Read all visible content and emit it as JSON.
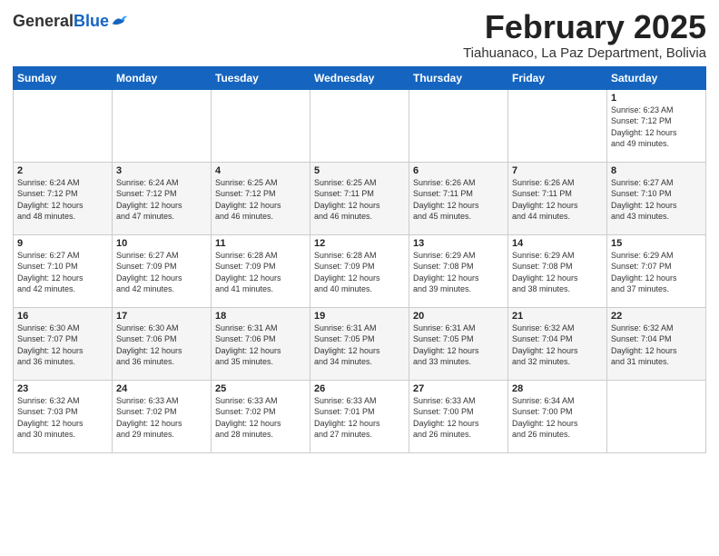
{
  "logo": {
    "general": "General",
    "blue": "Blue"
  },
  "title": {
    "month": "February 2025",
    "location": "Tiahuanaco, La Paz Department, Bolivia"
  },
  "headers": [
    "Sunday",
    "Monday",
    "Tuesday",
    "Wednesday",
    "Thursday",
    "Friday",
    "Saturday"
  ],
  "weeks": [
    [
      {
        "day": "",
        "info": ""
      },
      {
        "day": "",
        "info": ""
      },
      {
        "day": "",
        "info": ""
      },
      {
        "day": "",
        "info": ""
      },
      {
        "day": "",
        "info": ""
      },
      {
        "day": "",
        "info": ""
      },
      {
        "day": "1",
        "info": "Sunrise: 6:23 AM\nSunset: 7:12 PM\nDaylight: 12 hours\nand 49 minutes."
      }
    ],
    [
      {
        "day": "2",
        "info": "Sunrise: 6:24 AM\nSunset: 7:12 PM\nDaylight: 12 hours\nand 48 minutes."
      },
      {
        "day": "3",
        "info": "Sunrise: 6:24 AM\nSunset: 7:12 PM\nDaylight: 12 hours\nand 47 minutes."
      },
      {
        "day": "4",
        "info": "Sunrise: 6:25 AM\nSunset: 7:12 PM\nDaylight: 12 hours\nand 46 minutes."
      },
      {
        "day": "5",
        "info": "Sunrise: 6:25 AM\nSunset: 7:11 PM\nDaylight: 12 hours\nand 46 minutes."
      },
      {
        "day": "6",
        "info": "Sunrise: 6:26 AM\nSunset: 7:11 PM\nDaylight: 12 hours\nand 45 minutes."
      },
      {
        "day": "7",
        "info": "Sunrise: 6:26 AM\nSunset: 7:11 PM\nDaylight: 12 hours\nand 44 minutes."
      },
      {
        "day": "8",
        "info": "Sunrise: 6:27 AM\nSunset: 7:10 PM\nDaylight: 12 hours\nand 43 minutes."
      }
    ],
    [
      {
        "day": "9",
        "info": "Sunrise: 6:27 AM\nSunset: 7:10 PM\nDaylight: 12 hours\nand 42 minutes."
      },
      {
        "day": "10",
        "info": "Sunrise: 6:27 AM\nSunset: 7:09 PM\nDaylight: 12 hours\nand 42 minutes."
      },
      {
        "day": "11",
        "info": "Sunrise: 6:28 AM\nSunset: 7:09 PM\nDaylight: 12 hours\nand 41 minutes."
      },
      {
        "day": "12",
        "info": "Sunrise: 6:28 AM\nSunset: 7:09 PM\nDaylight: 12 hours\nand 40 minutes."
      },
      {
        "day": "13",
        "info": "Sunrise: 6:29 AM\nSunset: 7:08 PM\nDaylight: 12 hours\nand 39 minutes."
      },
      {
        "day": "14",
        "info": "Sunrise: 6:29 AM\nSunset: 7:08 PM\nDaylight: 12 hours\nand 38 minutes."
      },
      {
        "day": "15",
        "info": "Sunrise: 6:29 AM\nSunset: 7:07 PM\nDaylight: 12 hours\nand 37 minutes."
      }
    ],
    [
      {
        "day": "16",
        "info": "Sunrise: 6:30 AM\nSunset: 7:07 PM\nDaylight: 12 hours\nand 36 minutes."
      },
      {
        "day": "17",
        "info": "Sunrise: 6:30 AM\nSunset: 7:06 PM\nDaylight: 12 hours\nand 36 minutes."
      },
      {
        "day": "18",
        "info": "Sunrise: 6:31 AM\nSunset: 7:06 PM\nDaylight: 12 hours\nand 35 minutes."
      },
      {
        "day": "19",
        "info": "Sunrise: 6:31 AM\nSunset: 7:05 PM\nDaylight: 12 hours\nand 34 minutes."
      },
      {
        "day": "20",
        "info": "Sunrise: 6:31 AM\nSunset: 7:05 PM\nDaylight: 12 hours\nand 33 minutes."
      },
      {
        "day": "21",
        "info": "Sunrise: 6:32 AM\nSunset: 7:04 PM\nDaylight: 12 hours\nand 32 minutes."
      },
      {
        "day": "22",
        "info": "Sunrise: 6:32 AM\nSunset: 7:04 PM\nDaylight: 12 hours\nand 31 minutes."
      }
    ],
    [
      {
        "day": "23",
        "info": "Sunrise: 6:32 AM\nSunset: 7:03 PM\nDaylight: 12 hours\nand 30 minutes."
      },
      {
        "day": "24",
        "info": "Sunrise: 6:33 AM\nSunset: 7:02 PM\nDaylight: 12 hours\nand 29 minutes."
      },
      {
        "day": "25",
        "info": "Sunrise: 6:33 AM\nSunset: 7:02 PM\nDaylight: 12 hours\nand 28 minutes."
      },
      {
        "day": "26",
        "info": "Sunrise: 6:33 AM\nSunset: 7:01 PM\nDaylight: 12 hours\nand 27 minutes."
      },
      {
        "day": "27",
        "info": "Sunrise: 6:33 AM\nSunset: 7:00 PM\nDaylight: 12 hours\nand 26 minutes."
      },
      {
        "day": "28",
        "info": "Sunrise: 6:34 AM\nSunset: 7:00 PM\nDaylight: 12 hours\nand 26 minutes."
      },
      {
        "day": "",
        "info": ""
      }
    ]
  ]
}
